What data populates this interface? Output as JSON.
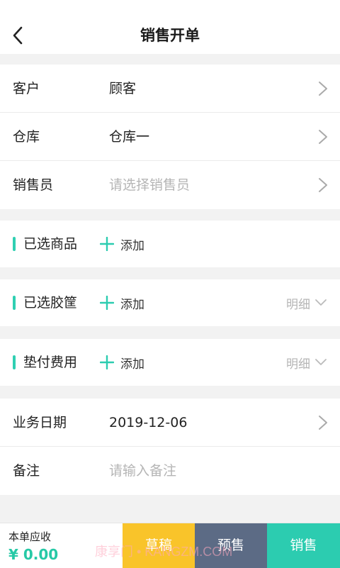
{
  "header": {
    "title": "销售开单"
  },
  "info": {
    "customer": {
      "label": "客户",
      "value": "顾客"
    },
    "warehouse": {
      "label": "仓库",
      "value": "仓库一"
    },
    "salesperson": {
      "label": "销售员",
      "placeholder": "请选择销售员"
    }
  },
  "sections": {
    "goods": {
      "title": "已选商品",
      "add_label": "添加"
    },
    "baskets": {
      "title": "已选胶筐",
      "add_label": "添加",
      "detail_label": "明细"
    },
    "advance": {
      "title": "垫付费用",
      "add_label": "添加",
      "detail_label": "明细"
    }
  },
  "business": {
    "date": {
      "label": "业务日期",
      "value": "2019-12-06"
    },
    "remark": {
      "label": "备注",
      "placeholder": "请输入备注"
    }
  },
  "footer": {
    "due_label": "本单应收",
    "due_amount": "¥ 0.00",
    "draft_label": "草稿",
    "presale_label": "预售",
    "sale_label": "销售"
  },
  "watermark": "康享门 • KANGZM.COM",
  "colors": {
    "accent": "#2cccb0",
    "draft": "#f9c42a",
    "presale": "#5c6b85",
    "background": "#f2f2f2"
  },
  "icons": {
    "back": "chevron-left-icon",
    "row_arrow": "chevron-right-icon",
    "add": "plus-icon",
    "expand": "chevron-down-icon"
  }
}
